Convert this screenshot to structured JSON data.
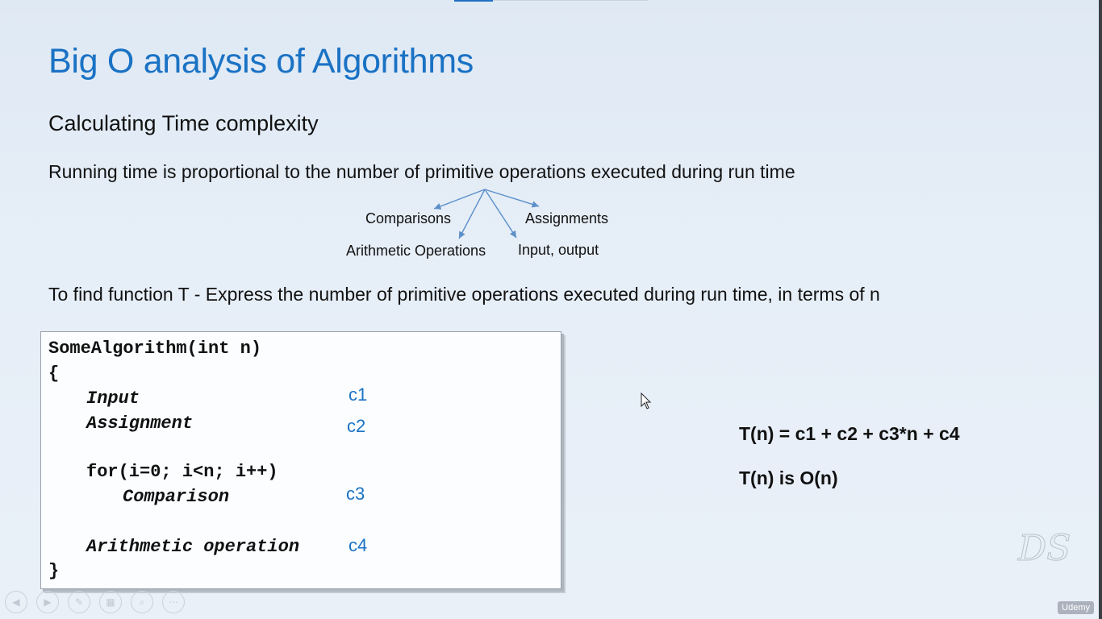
{
  "slide": {
    "title": "Big O analysis of Algorithms",
    "subtitle": "Calculating Time complexity",
    "statement": "Running time is proportional to the number of primitive operations executed during run time",
    "operations": {
      "comparisons": "Comparisons",
      "assignments": "Assignments",
      "arithmetic": "Arithmetic Operations",
      "io": "Input, output"
    },
    "find_t": "To find function T  -  Express the number of primitive operations executed during run time, in terms of n",
    "code": {
      "signature": "SomeAlgorithm(int n)",
      "open_brace": "{",
      "input": "Input",
      "assignment": "Assignment",
      "for_loop": "for(i=0; i<n; i++)",
      "comparison": "Comparison",
      "arithmetic": "Arithmetic operation",
      "close_brace": "}"
    },
    "costs": {
      "c1": "c1",
      "c2": "c2",
      "c3": "c3",
      "c4": "c4"
    },
    "equation": "T(n) = c1 + c2 + c3*n + c4",
    "conclusion": "T(n) is O(n)",
    "logo": "DS"
  },
  "player_controls": {
    "previous": "previous-icon",
    "next": "next-icon",
    "pen": "pen-icon",
    "slides": "slides-icon",
    "zoom": "zoom-icon",
    "more": "more-icon"
  },
  "watermark": "Udemy",
  "colors": {
    "title": "#1a72c4",
    "cost": "#1a72c4",
    "arrow": "#5b8fc9"
  }
}
